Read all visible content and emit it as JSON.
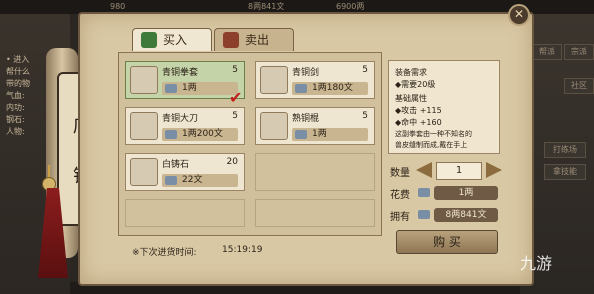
{
  "top_bar": {
    "cells": [
      "980",
      "8两841文",
      "6900两"
    ]
  },
  "left_panel": {
    "lines": [
      "• 进入",
      "帮什么",
      "带的物",
      "气血:",
      "内功:",
      "钢石:",
      "人物:"
    ]
  },
  "right_panel": {
    "buttons": [
      "帮派",
      "宗派",
      "社区",
      "打练场",
      "拿技能"
    ]
  },
  "shop": {
    "scroll_title_chars": [
      "店",
      "铺"
    ],
    "tabs": [
      {
        "label": "买入",
        "active": true
      },
      {
        "label": "卖出",
        "active": false
      }
    ],
    "items": [
      {
        "name": "青铜拳套",
        "qty": "5",
        "price": "1两",
        "selected": true
      },
      {
        "name": "青铜剑",
        "qty": "5",
        "price": "1两180文",
        "selected": false
      },
      {
        "name": "青铜大刀",
        "qty": "5",
        "price": "1两200文",
        "selected": false
      },
      {
        "name": "熟铜棍",
        "qty": "5",
        "price": "1两",
        "selected": false
      },
      {
        "name": "白铸石",
        "qty": "20",
        "price": "22文",
        "selected": false
      }
    ],
    "check_mark": "✔",
    "restock_label": "※下次进货时间:",
    "restock_time": "15:19:19",
    "detail": {
      "lines": [
        "装备需求",
        "◆需要20级",
        "基础属性",
        "◆攻击 +115",
        "◆命中 +160",
        "这副拳套由一种不知名的",
        "兽皮缝制而成,戴在手上"
      ]
    },
    "quantity_label": "数量",
    "quantity_value": "1",
    "cost_label": "花费",
    "cost_value": "1两",
    "own_label": "拥有",
    "own_value": "8两841文",
    "buy_button": "购 买",
    "close_icon": "✕"
  },
  "watermark": "九游",
  "colors": {
    "panel": "#d9c8a4",
    "selected_item": "#c4d3a8",
    "check": "#c0201b"
  }
}
